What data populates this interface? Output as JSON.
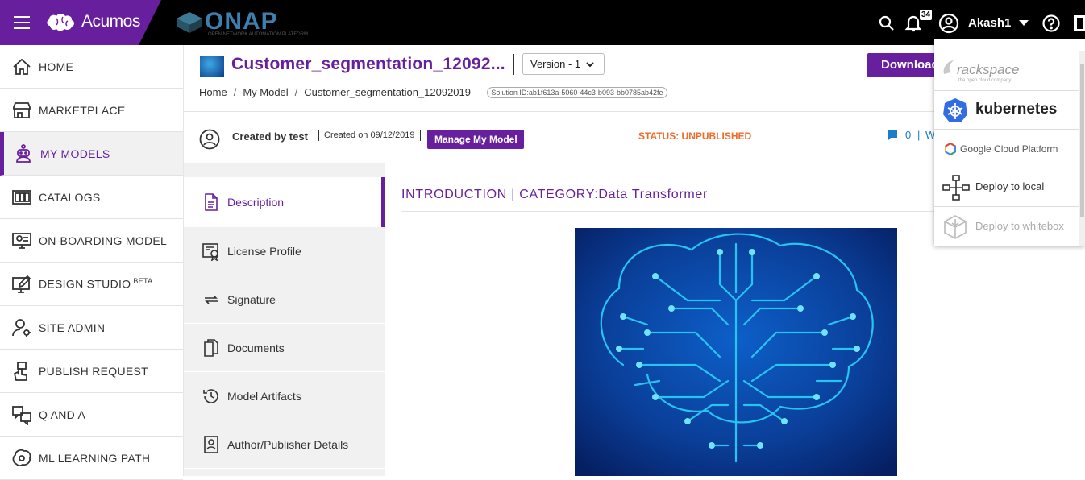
{
  "app": {
    "brand": "Acumos",
    "partner_logo": "ONAP",
    "partner_tagline": "OPEN NETWORK AUTOMATION PLATFORM"
  },
  "topbar": {
    "notification_count": "34",
    "username": "Akash1"
  },
  "sidebar": {
    "items": [
      {
        "label": "HOME",
        "icon": "home-icon"
      },
      {
        "label": "MARKETPLACE",
        "icon": "storefront-icon"
      },
      {
        "label": "MY MODELS",
        "icon": "robot-icon",
        "active": true
      },
      {
        "label": "CATALOGS",
        "icon": "catalog-icon"
      },
      {
        "label": "ON-BOARDING MODEL",
        "icon": "onboarding-icon"
      },
      {
        "label": "DESIGN STUDIO",
        "sup": "BETA",
        "icon": "design-icon"
      },
      {
        "label": "SITE ADMIN",
        "icon": "admin-icon"
      },
      {
        "label": "PUBLISH REQUEST",
        "icon": "publish-icon"
      },
      {
        "label": "Q AND A",
        "icon": "qa-icon"
      },
      {
        "label": "ML LEARNING PATH",
        "icon": "brain-gear-icon"
      }
    ]
  },
  "header": {
    "title": "Customer_segmentation_12092...",
    "version": "Version - 1",
    "download_label": "Download",
    "breadcrumb": {
      "home": "Home",
      "sep": "/",
      "my_model": "My Model",
      "current": "Customer_segmentation_12092019",
      "dash": "-",
      "solution_id": "Solution ID:ab1f613a-5060-44c3-b093-bb0785ab42fe"
    }
  },
  "subbar": {
    "created_by": "Created by test",
    "created_on": "Created on 09/12/2019",
    "manage_label": "Manage My Model",
    "status": "STATUS: UNPUBLISHED",
    "comment_count": "0",
    "sep": "|",
    "more": "W"
  },
  "tabs": [
    {
      "label": "Description",
      "icon": "document-icon",
      "active": true
    },
    {
      "label": "License Profile",
      "icon": "license-icon"
    },
    {
      "label": "Signature",
      "icon": "signature-icon"
    },
    {
      "label": "Documents",
      "icon": "documents-icon"
    },
    {
      "label": "Model Artifacts",
      "icon": "history-icon"
    },
    {
      "label": "Author/Publisher Details",
      "icon": "author-icon"
    }
  ],
  "main": {
    "heading": "INTRODUCTION | CATEGORY:Data Transformer"
  },
  "deploy_menu": {
    "rackspace": "rackspace",
    "rackspace_tag": "the open cloud company",
    "kubernetes": "kubernetes",
    "gcp": "Google Cloud Platform",
    "local": "Deploy to local",
    "whitebox": "Deploy to whitebox"
  },
  "colors": {
    "brand_purple": "#681f9e",
    "status_orange": "#ef6b2a",
    "link_blue": "#1c7cc7"
  }
}
